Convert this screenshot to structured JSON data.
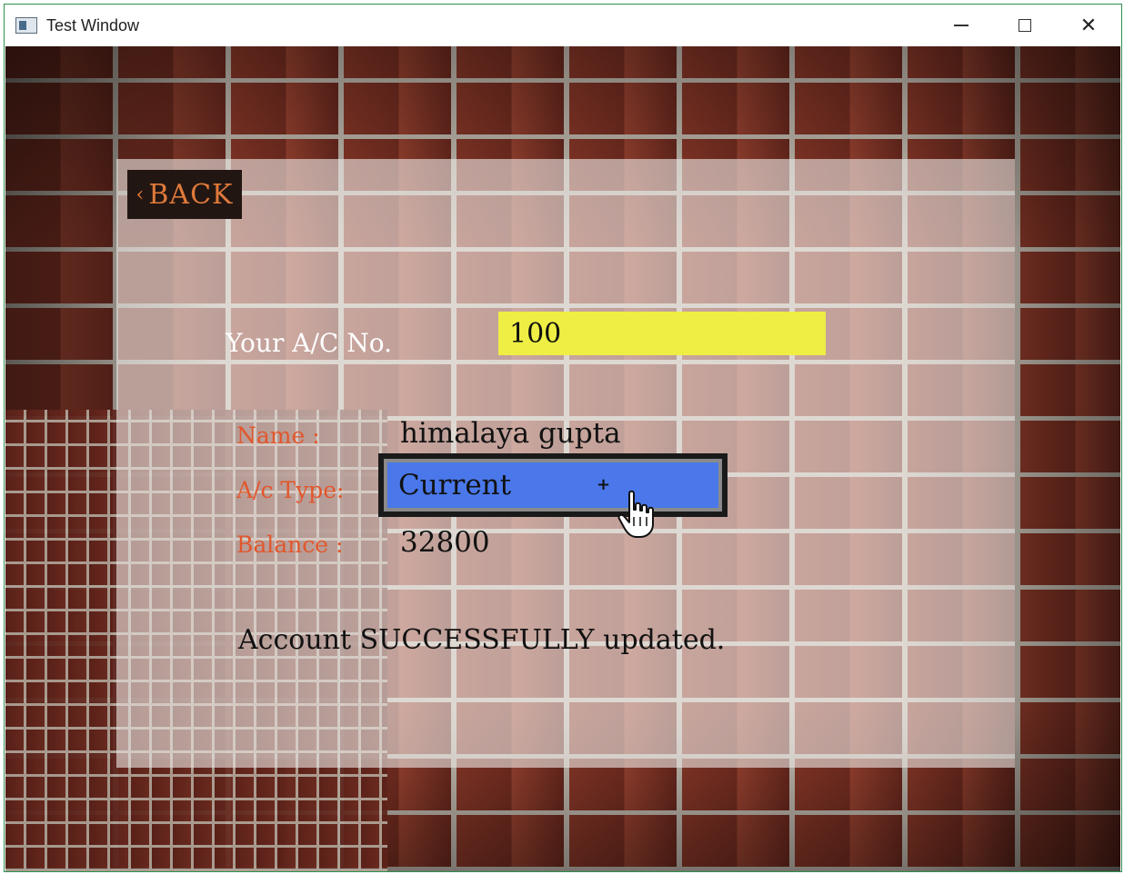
{
  "window": {
    "title": "Test Window",
    "controls": {
      "minimize_icon": "minimize-icon",
      "maximize_icon": "maximize-icon",
      "close_icon": "close-icon",
      "close_glyph": "✕"
    }
  },
  "back_button": {
    "label": "BACK",
    "chevron": "‹"
  },
  "account": {
    "acno_label": "Your A/C No.",
    "acno_value": "100"
  },
  "details": {
    "name_label": "Name   :",
    "name_value": "himalaya gupta",
    "type_label": "A/c Type:",
    "type_value": "Current",
    "balance_label": "Balance :",
    "balance_value": "32800"
  },
  "status_message": "Account SUCCESSFULLY updated.",
  "colors": {
    "input_bg": "#eeee44",
    "dropdown_bg": "#4a78ea",
    "label_color": "#e2572c",
    "back_text": "#e07a3a"
  }
}
